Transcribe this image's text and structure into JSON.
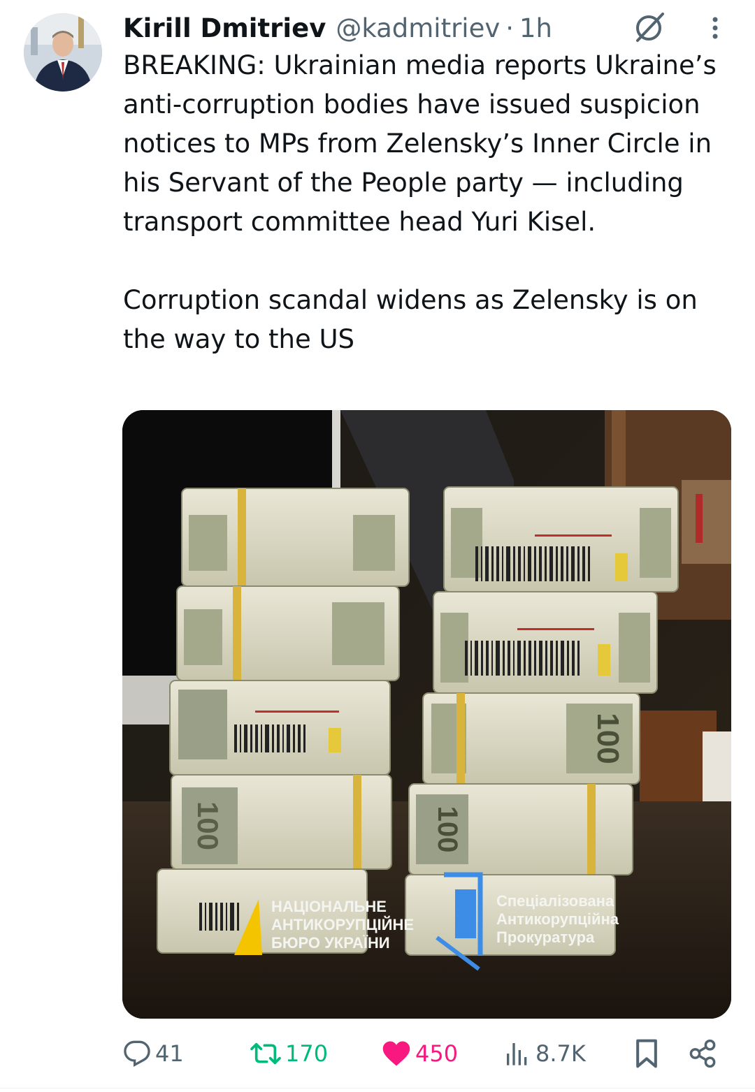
{
  "author": {
    "name": "Kirill Dmitriev",
    "handle": "@kadmitriev",
    "separator": "·",
    "time": "1h"
  },
  "tweet": {
    "text": "BREAKING: Ukrainian media reports Ukraine’s anti-corruption bodies have issued suspicion notices to MPs from Zelensky’s Inner Circle in his Servant of the People party — including transport committee head Yuri Kisel.\n\nCorruption scandal widens as Zelensky is on the way to the US"
  },
  "media": {
    "overlay_left": [
      "НАЦІОНАЛЬНЕ",
      "АНТИКОРУПЦІЙНЕ",
      "БЮРО УКРАЇНИ"
    ],
    "overlay_right": [
      "Спеціалізована",
      "Антикорупційна",
      "Прокуратура"
    ],
    "banknote_label": "100"
  },
  "actions": {
    "reply_count": "41",
    "retweet_count": "170",
    "like_count": "450",
    "views_count": "8.7K"
  },
  "icons": {
    "grok": "grok-icon",
    "more": "more-icon",
    "reply": "reply-icon",
    "retweet": "retweet-icon",
    "like": "heart-icon",
    "views": "views-icon",
    "bookmark": "bookmark-icon",
    "share": "share-icon"
  },
  "colors": {
    "text": "#0f1419",
    "secondary": "#536471",
    "retweet": "#00ba7c",
    "like": "#f91880",
    "nabu_yellow": "#f5c400",
    "sap_blue": "#3d8ce6"
  }
}
